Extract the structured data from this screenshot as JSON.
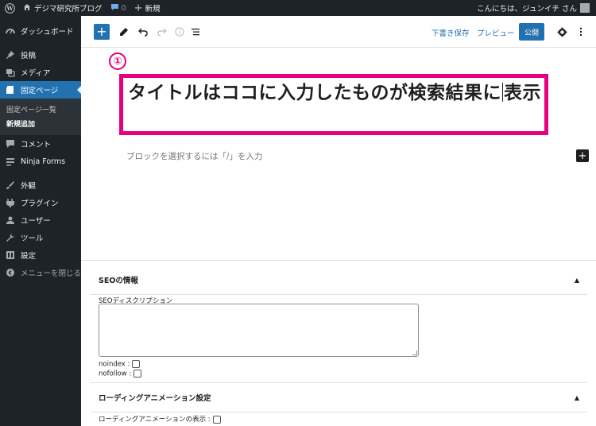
{
  "adminbar": {
    "site_name": "デジマ研究所ブログ",
    "comments_count": "0",
    "new_label": "新規",
    "greeting": "こんにちは、ジュンイチ さん"
  },
  "sidebar": {
    "items": [
      {
        "label": "ダッシュボード",
        "icon": "dashboard-icon"
      },
      {
        "label": "投稿",
        "icon": "pin-icon"
      },
      {
        "label": "メディア",
        "icon": "media-icon"
      },
      {
        "label": "固定ページ",
        "icon": "page-icon"
      },
      {
        "label": "コメント",
        "icon": "comment-icon"
      },
      {
        "label": "Ninja Forms",
        "icon": "form-icon"
      },
      {
        "label": "外観",
        "icon": "brush-icon"
      },
      {
        "label": "プラグイン",
        "icon": "plugin-icon"
      },
      {
        "label": "ユーザー",
        "icon": "user-icon"
      },
      {
        "label": "ツール",
        "icon": "wrench-icon"
      },
      {
        "label": "設定",
        "icon": "settings-icon"
      },
      {
        "label": "メニューを閉じる",
        "icon": "collapse-icon"
      }
    ],
    "submenu": [
      "固定ページ一覧",
      "新規追加"
    ]
  },
  "header": {
    "save_draft": "下書き保存",
    "preview": "プレビュー",
    "publish": "公開"
  },
  "editor": {
    "badge": "①",
    "title_part1": "タイトルはココに入力したものが検索結果に",
    "title_part2": "表示",
    "placeholder": "ブロックを選択するには「/」を入力"
  },
  "meta": {
    "seo_heading": "SEOの情報",
    "seo_description_label": "SEOディスクリプション",
    "noindex_label": "noindex :",
    "nofollow_label": "nofollow :",
    "loading_heading": "ローディングアニメーション設定",
    "loading_display_label": "ローディングアニメーションの表示 :"
  },
  "colors": {
    "accent": "#2271b1",
    "highlight": "#e5007f",
    "sidebar_bg": "#1d2327"
  }
}
